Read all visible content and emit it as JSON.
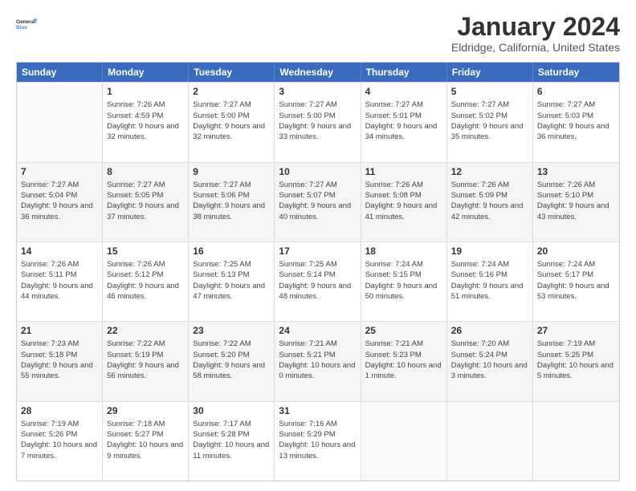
{
  "logo": {
    "line1": "General",
    "line2": "Blue"
  },
  "title": "January 2024",
  "subtitle": "Eldridge, California, United States",
  "weekdays": [
    "Sunday",
    "Monday",
    "Tuesday",
    "Wednesday",
    "Thursday",
    "Friday",
    "Saturday"
  ],
  "weeks": [
    [
      {
        "day": "",
        "sunrise": "",
        "sunset": "",
        "daylight": ""
      },
      {
        "day": "1",
        "sunrise": "Sunrise: 7:26 AM",
        "sunset": "Sunset: 4:59 PM",
        "daylight": "Daylight: 9 hours and 32 minutes."
      },
      {
        "day": "2",
        "sunrise": "Sunrise: 7:27 AM",
        "sunset": "Sunset: 5:00 PM",
        "daylight": "Daylight: 9 hours and 32 minutes."
      },
      {
        "day": "3",
        "sunrise": "Sunrise: 7:27 AM",
        "sunset": "Sunset: 5:00 PM",
        "daylight": "Daylight: 9 hours and 33 minutes."
      },
      {
        "day": "4",
        "sunrise": "Sunrise: 7:27 AM",
        "sunset": "Sunset: 5:01 PM",
        "daylight": "Daylight: 9 hours and 34 minutes."
      },
      {
        "day": "5",
        "sunrise": "Sunrise: 7:27 AM",
        "sunset": "Sunset: 5:02 PM",
        "daylight": "Daylight: 9 hours and 35 minutes."
      },
      {
        "day": "6",
        "sunrise": "Sunrise: 7:27 AM",
        "sunset": "Sunset: 5:03 PM",
        "daylight": "Daylight: 9 hours and 36 minutes."
      }
    ],
    [
      {
        "day": "7",
        "sunrise": "Sunrise: 7:27 AM",
        "sunset": "Sunset: 5:04 PM",
        "daylight": "Daylight: 9 hours and 36 minutes."
      },
      {
        "day": "8",
        "sunrise": "Sunrise: 7:27 AM",
        "sunset": "Sunset: 5:05 PM",
        "daylight": "Daylight: 9 hours and 37 minutes."
      },
      {
        "day": "9",
        "sunrise": "Sunrise: 7:27 AM",
        "sunset": "Sunset: 5:06 PM",
        "daylight": "Daylight: 9 hours and 38 minutes."
      },
      {
        "day": "10",
        "sunrise": "Sunrise: 7:27 AM",
        "sunset": "Sunset: 5:07 PM",
        "daylight": "Daylight: 9 hours and 40 minutes."
      },
      {
        "day": "11",
        "sunrise": "Sunrise: 7:26 AM",
        "sunset": "Sunset: 5:08 PM",
        "daylight": "Daylight: 9 hours and 41 minutes."
      },
      {
        "day": "12",
        "sunrise": "Sunrise: 7:26 AM",
        "sunset": "Sunset: 5:09 PM",
        "daylight": "Daylight: 9 hours and 42 minutes."
      },
      {
        "day": "13",
        "sunrise": "Sunrise: 7:26 AM",
        "sunset": "Sunset: 5:10 PM",
        "daylight": "Daylight: 9 hours and 43 minutes."
      }
    ],
    [
      {
        "day": "14",
        "sunrise": "Sunrise: 7:26 AM",
        "sunset": "Sunset: 5:11 PM",
        "daylight": "Daylight: 9 hours and 44 minutes."
      },
      {
        "day": "15",
        "sunrise": "Sunrise: 7:26 AM",
        "sunset": "Sunset: 5:12 PM",
        "daylight": "Daylight: 9 hours and 46 minutes."
      },
      {
        "day": "16",
        "sunrise": "Sunrise: 7:25 AM",
        "sunset": "Sunset: 5:13 PM",
        "daylight": "Daylight: 9 hours and 47 minutes."
      },
      {
        "day": "17",
        "sunrise": "Sunrise: 7:25 AM",
        "sunset": "Sunset: 5:14 PM",
        "daylight": "Daylight: 9 hours and 48 minutes."
      },
      {
        "day": "18",
        "sunrise": "Sunrise: 7:24 AM",
        "sunset": "Sunset: 5:15 PM",
        "daylight": "Daylight: 9 hours and 50 minutes."
      },
      {
        "day": "19",
        "sunrise": "Sunrise: 7:24 AM",
        "sunset": "Sunset: 5:16 PM",
        "daylight": "Daylight: 9 hours and 51 minutes."
      },
      {
        "day": "20",
        "sunrise": "Sunrise: 7:24 AM",
        "sunset": "Sunset: 5:17 PM",
        "daylight": "Daylight: 9 hours and 53 minutes."
      }
    ],
    [
      {
        "day": "21",
        "sunrise": "Sunrise: 7:23 AM",
        "sunset": "Sunset: 5:18 PM",
        "daylight": "Daylight: 9 hours and 55 minutes."
      },
      {
        "day": "22",
        "sunrise": "Sunrise: 7:22 AM",
        "sunset": "Sunset: 5:19 PM",
        "daylight": "Daylight: 9 hours and 56 minutes."
      },
      {
        "day": "23",
        "sunrise": "Sunrise: 7:22 AM",
        "sunset": "Sunset: 5:20 PM",
        "daylight": "Daylight: 9 hours and 58 minutes."
      },
      {
        "day": "24",
        "sunrise": "Sunrise: 7:21 AM",
        "sunset": "Sunset: 5:21 PM",
        "daylight": "Daylight: 10 hours and 0 minutes."
      },
      {
        "day": "25",
        "sunrise": "Sunrise: 7:21 AM",
        "sunset": "Sunset: 5:23 PM",
        "daylight": "Daylight: 10 hours and 1 minute."
      },
      {
        "day": "26",
        "sunrise": "Sunrise: 7:20 AM",
        "sunset": "Sunset: 5:24 PM",
        "daylight": "Daylight: 10 hours and 3 minutes."
      },
      {
        "day": "27",
        "sunrise": "Sunrise: 7:19 AM",
        "sunset": "Sunset: 5:25 PM",
        "daylight": "Daylight: 10 hours and 5 minutes."
      }
    ],
    [
      {
        "day": "28",
        "sunrise": "Sunrise: 7:19 AM",
        "sunset": "Sunset: 5:26 PM",
        "daylight": "Daylight: 10 hours and 7 minutes."
      },
      {
        "day": "29",
        "sunrise": "Sunrise: 7:18 AM",
        "sunset": "Sunset: 5:27 PM",
        "daylight": "Daylight: 10 hours and 9 minutes."
      },
      {
        "day": "30",
        "sunrise": "Sunrise: 7:17 AM",
        "sunset": "Sunset: 5:28 PM",
        "daylight": "Daylight: 10 hours and 11 minutes."
      },
      {
        "day": "31",
        "sunrise": "Sunrise: 7:16 AM",
        "sunset": "Sunset: 5:29 PM",
        "daylight": "Daylight: 10 hours and 13 minutes."
      },
      {
        "day": "",
        "sunrise": "",
        "sunset": "",
        "daylight": ""
      },
      {
        "day": "",
        "sunrise": "",
        "sunset": "",
        "daylight": ""
      },
      {
        "day": "",
        "sunrise": "",
        "sunset": "",
        "daylight": ""
      }
    ]
  ]
}
